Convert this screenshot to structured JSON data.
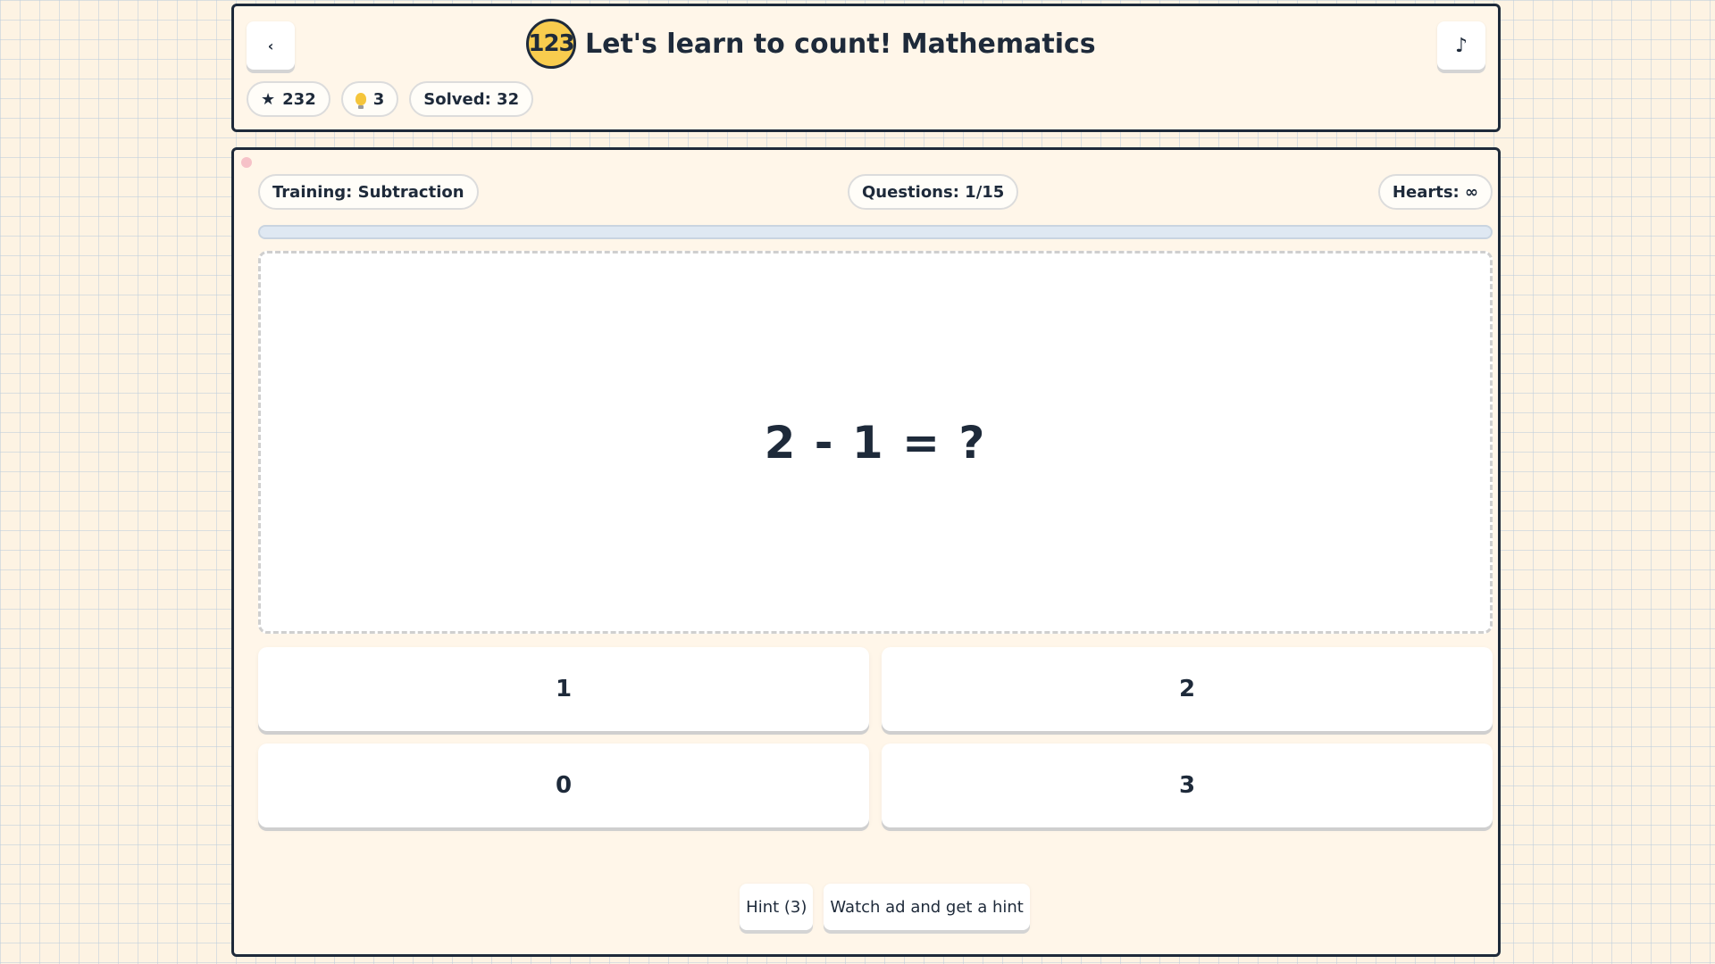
{
  "header": {
    "back_icon": "‹",
    "logo_text": "123",
    "title": "Let's learn to count! Mathematics",
    "music_icon": "♪"
  },
  "stats": {
    "star_icon": "★",
    "stars": "232",
    "bulb_icon": "bulb-icon",
    "hints": "3",
    "solved": "Solved: 32"
  },
  "game": {
    "mode": "Training: Subtraction",
    "questions": "Questions: 1/15",
    "hearts": "Hearts: ∞",
    "progress_fraction": 0,
    "question": "2 - 1 = ?",
    "answers": [
      "1",
      "2",
      "0",
      "3"
    ],
    "hint_button": "Hint (3)",
    "ad_hint_button": "Watch ad and get a hint"
  },
  "colors": {
    "ink": "#1e2a3a",
    "logo_yellow": "#f8cc4e",
    "panel_bg": "#fff6e9",
    "page_bg": "#fdf3e3"
  }
}
